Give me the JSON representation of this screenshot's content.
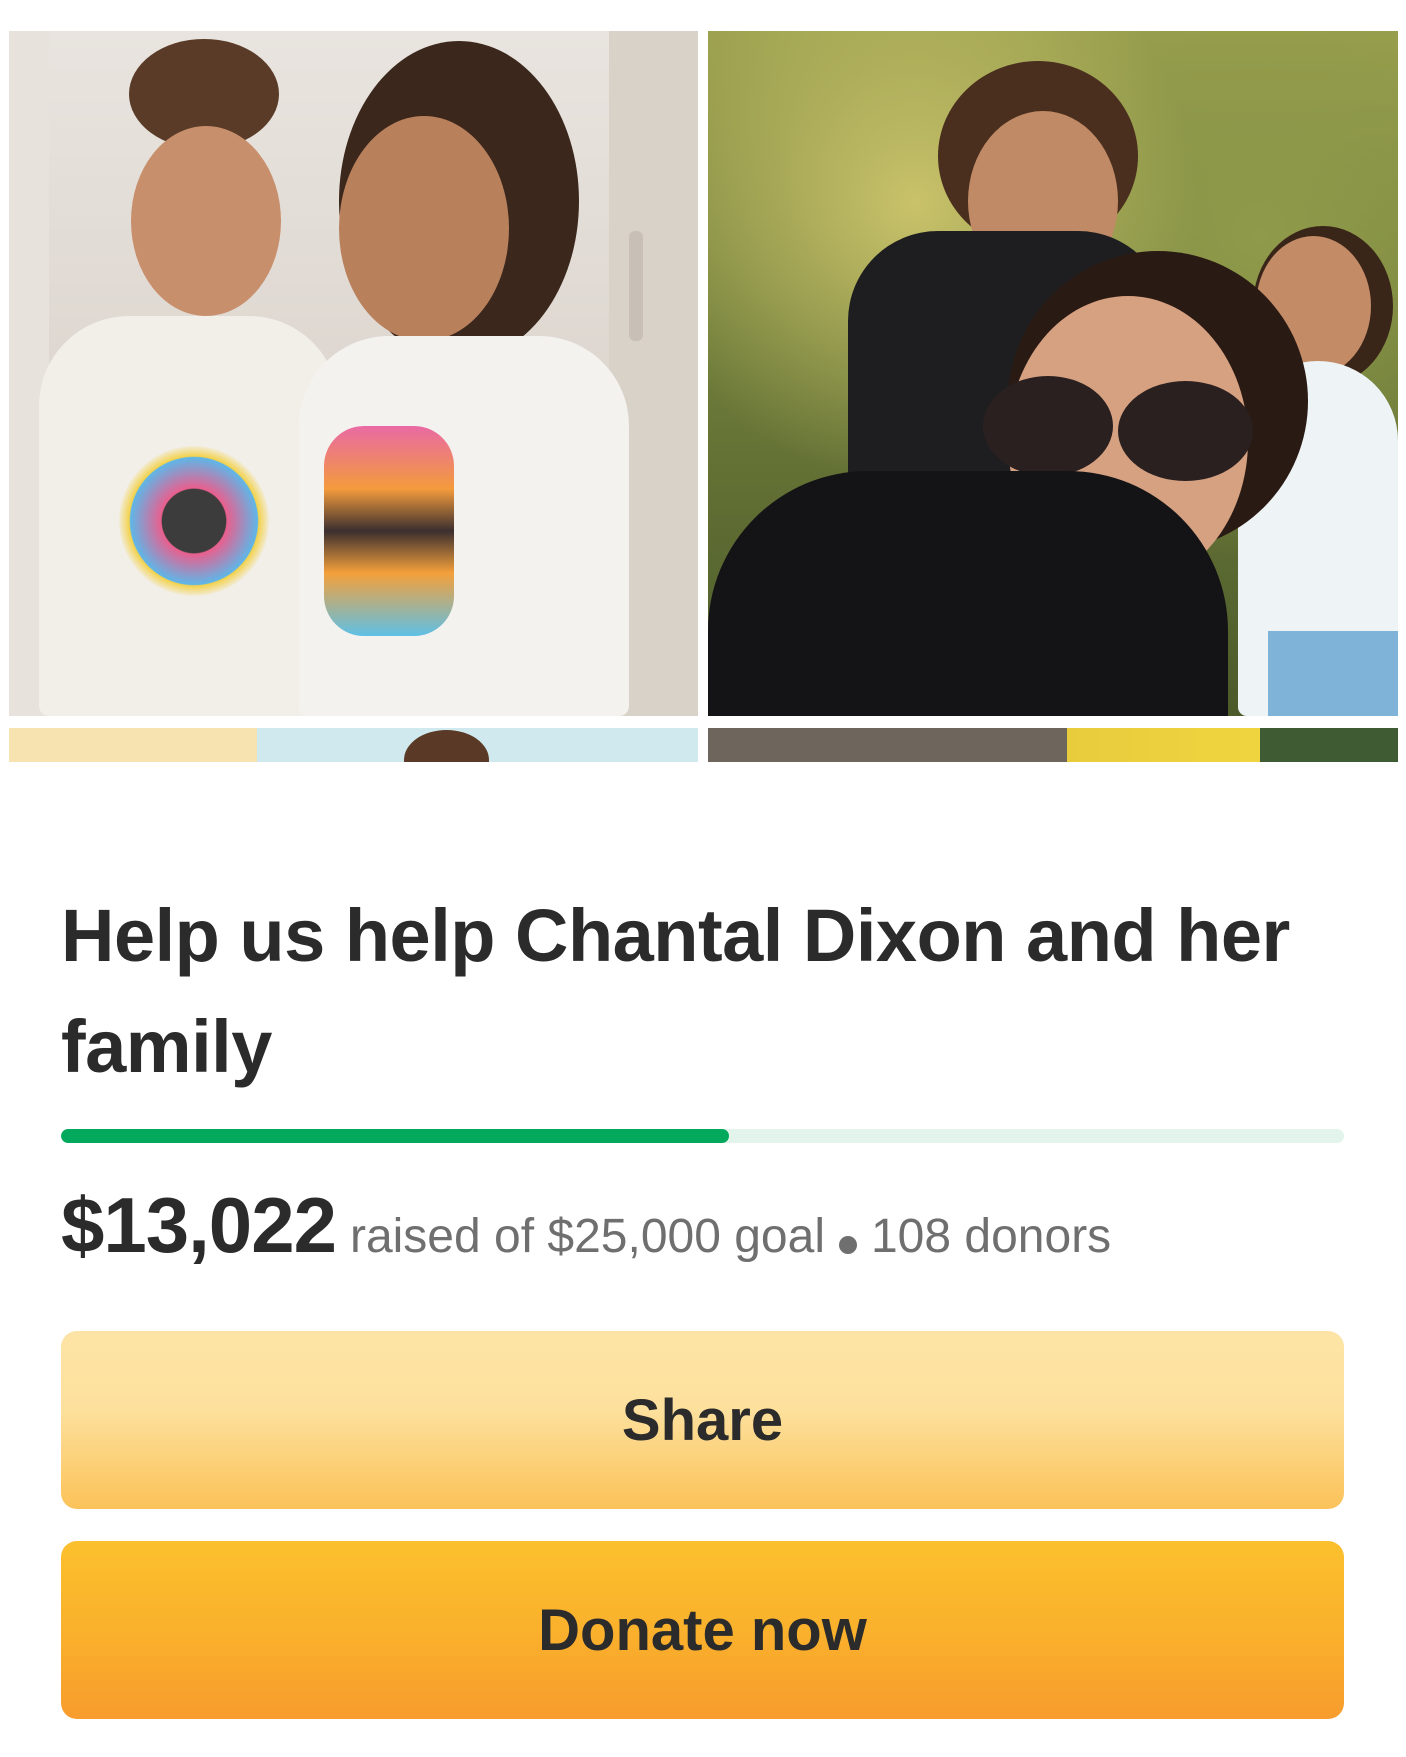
{
  "campaign": {
    "title": "Help us help Chantal Dixon and her family",
    "progress_fraction": 0.5209,
    "amount_raised": "$13,022",
    "goal_text": "raised of $25,000 goal",
    "donors_text": "108 donors"
  },
  "actions": {
    "share_label": "Share",
    "donate_label": "Donate now"
  },
  "colors": {
    "progress_fill": "#02a95c",
    "progress_track": "#e2f4ec",
    "share_button": "#fde09c",
    "donate_button": "#fab12c",
    "text": "#2b2b2b",
    "muted_text": "#6f6f6f"
  }
}
